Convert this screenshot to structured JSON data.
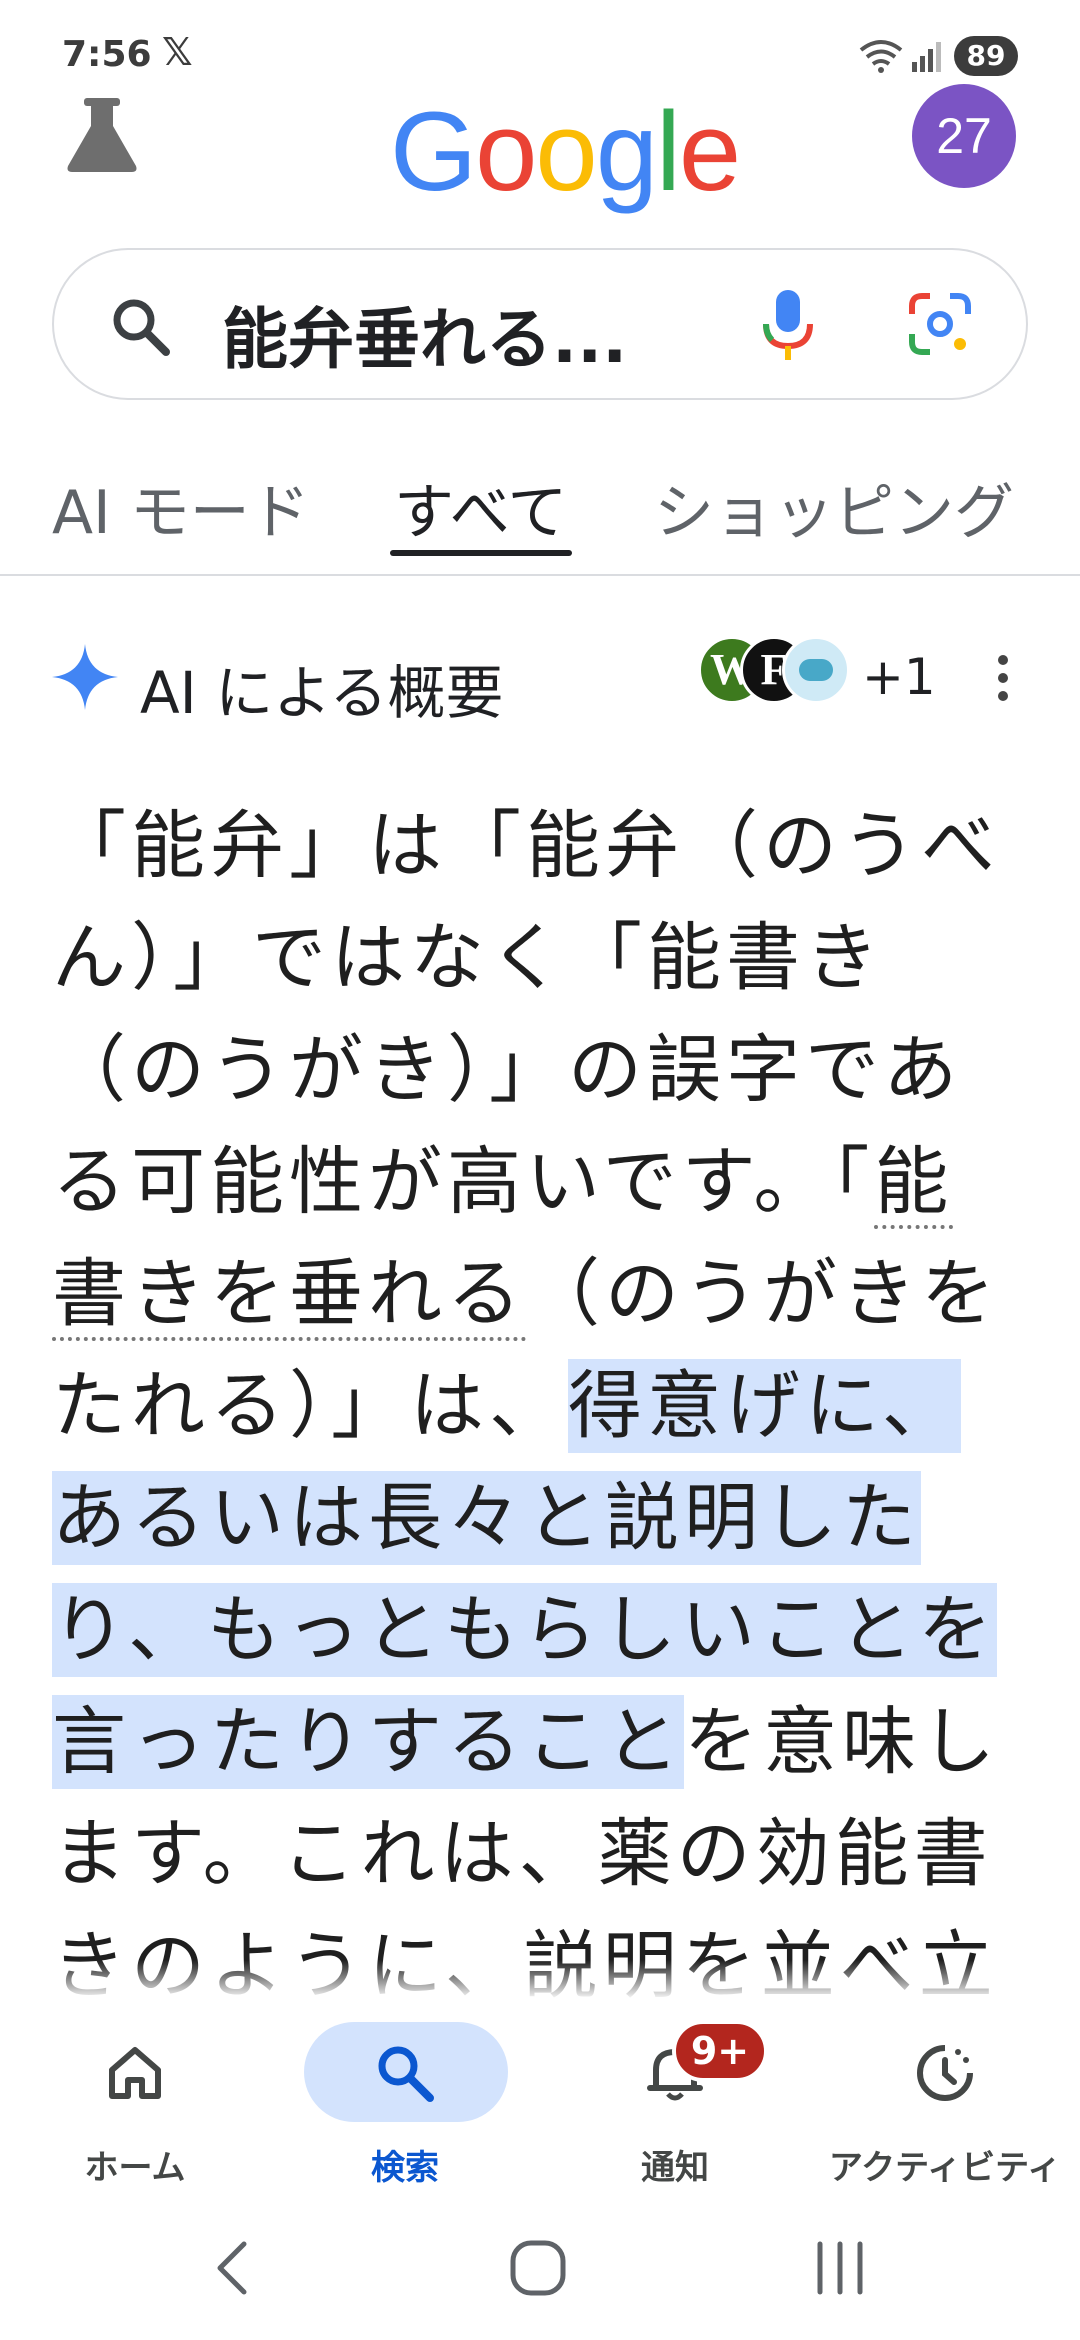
{
  "status_bar": {
    "time": "7:56",
    "notification_icon": "x-logo",
    "battery": "89"
  },
  "header": {
    "labs_icon": "flask-icon",
    "logo": [
      "G",
      "o",
      "o",
      "g",
      "l",
      "e"
    ],
    "logo_colors": [
      "#4285f4",
      "#ea4335",
      "#fbbc05",
      "#4285f4",
      "#34a853",
      "#ea4335"
    ],
    "avatar": "27",
    "avatar_color": "#7b54c4"
  },
  "search": {
    "query": "能弁垂れる..."
  },
  "tabs": [
    {
      "label": "AI モード",
      "active": false
    },
    {
      "label": "すべて",
      "active": true
    },
    {
      "label": "ショッピング",
      "active": false
    }
  ],
  "ai_overview": {
    "title": "AI による概要",
    "sources": [
      {
        "letter": "W",
        "color": "#3d7a1e"
      },
      {
        "letter": "F",
        "color": "#111111"
      },
      {
        "letter": "",
        "color": "#cfeaf6"
      }
    ],
    "more_sources": "+1",
    "text": {
      "p1": "「能弁」は「能弁（のうべん）」ではなく「能書き（のうがき）」の誤字である可能性が高いです。「",
      "link": "能書きを垂れる",
      "p2": "（のうがきをたれる）」は、",
      "highlight": "得意げに、あるいは長々と説明したり、もっともらしいことを言ったりすること",
      "p3": "を意味します。これは、薬の効能書きのように、説明を並べ立てることに由来してい"
    }
  },
  "bottom_nav": [
    {
      "label": "ホーム",
      "icon": "home-icon",
      "active": false
    },
    {
      "label": "検索",
      "icon": "search-icon",
      "active": true
    },
    {
      "label": "通知",
      "icon": "bell-icon",
      "active": false,
      "badge": "9+"
    },
    {
      "label": "アクティビティ",
      "icon": "activity-icon",
      "active": false
    }
  ],
  "colors": {
    "accent": "#0b57d0",
    "highlight": "#d3e3fd",
    "badge": "#b3261e"
  }
}
